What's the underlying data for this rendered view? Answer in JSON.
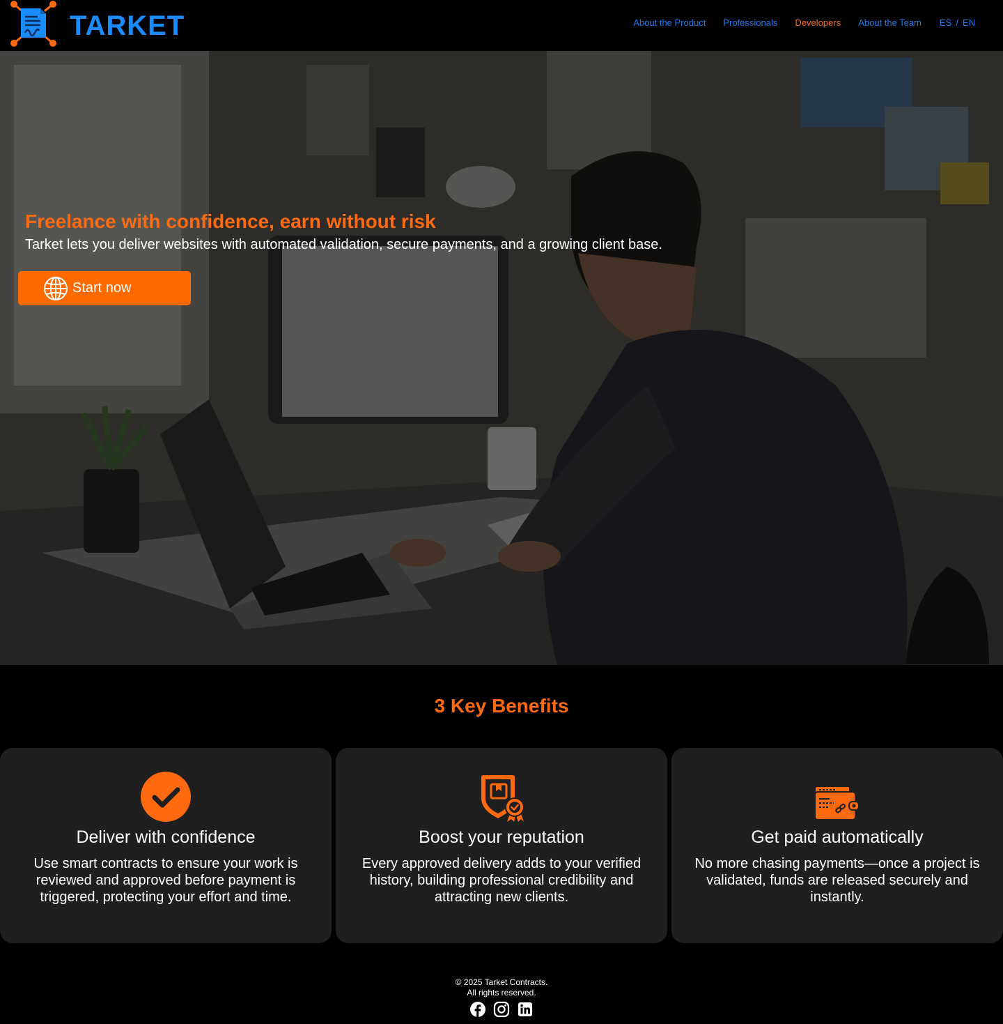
{
  "brand": {
    "name": "TARKET",
    "color": "#1a8cff",
    "accent": "#ff6a10"
  },
  "nav": {
    "items": [
      {
        "label": "About the Product"
      },
      {
        "label": "Professionals"
      },
      {
        "label": "Developers",
        "active": true
      },
      {
        "label": "About the Team"
      }
    ],
    "lang": {
      "es": "ES",
      "sep": "/",
      "en": "EN"
    }
  },
  "hero": {
    "title": "Freelance with confidence, earn without risk",
    "subtitle": "Tarket lets you deliver websites with automated validation, secure payments, and a growing client base.",
    "cta_label": "Start now",
    "cta_icon": "globe-icon"
  },
  "benefits": {
    "title": "3 Key Benefits",
    "cards": [
      {
        "icon": "check-circle-icon",
        "title": "Deliver with confidence",
        "text": "Use smart contracts to ensure your work is reviewed and approved before payment is triggered, protecting your effort and time."
      },
      {
        "icon": "shield-badge-icon",
        "title": "Boost your reputation",
        "text": "Every approved delivery adds to your verified history, building professional credibility and attracting new clients."
      },
      {
        "icon": "wallet-icon",
        "title": "Get paid automatically",
        "text": "No more chasing payments—once a project is validated, funds are released securely and instantly."
      }
    ]
  },
  "footer": {
    "copyright": "© 2025 Tarket Contracts.",
    "rights": "All rights reserved.",
    "socials": [
      "facebook-icon",
      "instagram-icon",
      "linkedin-icon"
    ]
  }
}
